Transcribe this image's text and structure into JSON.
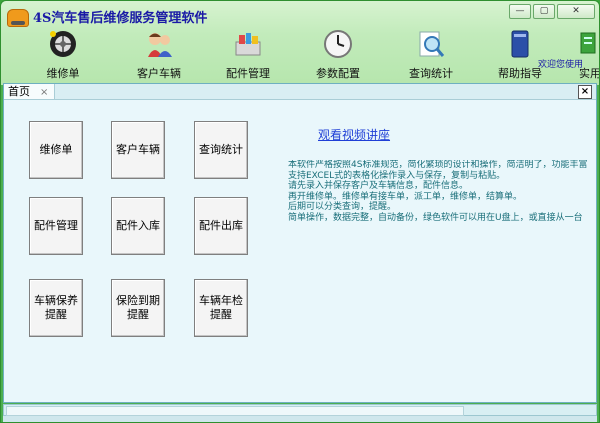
{
  "window": {
    "title": "4S汽车售后维修服务管理软件",
    "controls": [
      "—",
      "▢",
      "✕"
    ]
  },
  "toolbar": {
    "items": [
      {
        "label": "维修单",
        "icon": "wheel-icon"
      },
      {
        "label": "客户车辆",
        "icon": "people-icon"
      },
      {
        "label": "配件管理",
        "icon": "parts-icon"
      },
      {
        "label": "参数配置",
        "icon": "clock-icon"
      },
      {
        "label": "查询统计",
        "icon": "search-doc-icon"
      },
      {
        "label": "帮助指导",
        "icon": "book-icon"
      },
      {
        "label": "实用",
        "icon": "tools-icon"
      }
    ],
    "welcome": "欢迎您使用"
  },
  "tabs": [
    {
      "label": "首页",
      "close": "×"
    }
  ],
  "close_all": "×",
  "home": {
    "buttons": [
      {
        "label": "维修单"
      },
      {
        "label": "客户车辆"
      },
      {
        "label": "查询统计"
      },
      {
        "label": "配件管理"
      },
      {
        "label": "配件入库"
      },
      {
        "label": "配件出库"
      },
      {
        "label": "车辆保养\n提醒"
      },
      {
        "label": "保险到期\n提醒"
      },
      {
        "label": "车辆年检\n提醒"
      }
    ],
    "video_link": "观看视频讲座",
    "description": [
      "本软件严格按照4S标准规范，简化繁琐的设计和操作，简洁明了，功能丰富",
      "支持EXCEL式的表格化操作录入与保存，复制与粘贴。",
      "请先录入并保存客户及车辆信息，配件信息。",
      "再开维修单。维修单有接车单，派工单，维修单，结算单。",
      "后期可以分类查询，提醒。",
      "简单操作，数据完整，自动备份，绿色软件可以用在U盘上，或直接从一台"
    ]
  }
}
